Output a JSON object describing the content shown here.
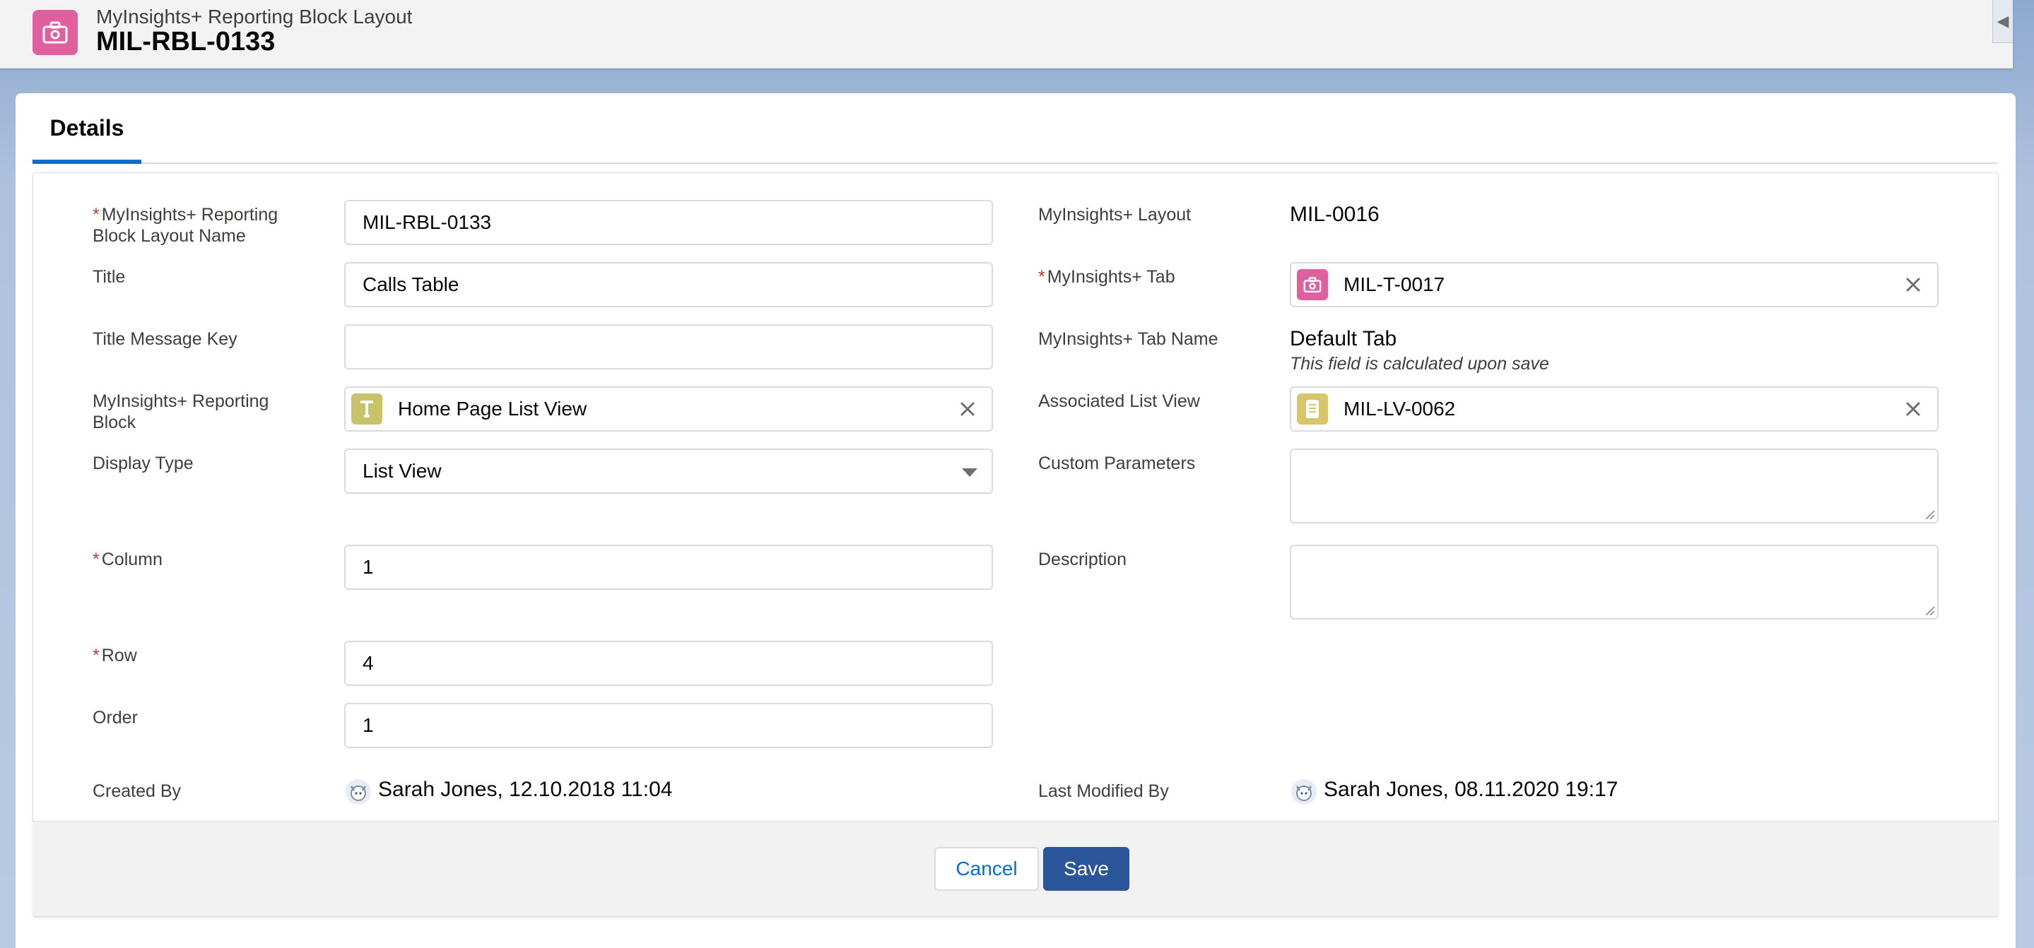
{
  "header": {
    "object_label": "MyInsights+ Reporting Block Layout",
    "record_name": "MIL-RBL-0133",
    "icon": "toolbox-icon",
    "icon_color": "#e0609f"
  },
  "tabs": [
    {
      "label": "Details",
      "active": true
    }
  ],
  "left_fields": {
    "name": {
      "label_line1": "MyInsights+ Reporting",
      "label_line2": "Block Layout Name",
      "required": "*",
      "value": "MIL-RBL-0133"
    },
    "title": {
      "label": "Title",
      "value": "Calls Table"
    },
    "title_message_key": {
      "label": "Title Message Key",
      "value": ""
    },
    "reporting_block": {
      "label_line1": "MyInsights+ Reporting",
      "label_line2": "Block",
      "value": "Home Page List View",
      "icon": "reporting-block-icon",
      "icon_color": "#c8c36b"
    },
    "display_type": {
      "label": "Display Type",
      "value": "List View"
    },
    "column": {
      "label": "Column",
      "required": "*",
      "value": "1"
    },
    "row": {
      "label": "Row",
      "required": "*",
      "value": "4"
    },
    "order": {
      "label": "Order",
      "value": "1"
    },
    "created_by": {
      "label": "Created By",
      "value": "Sarah Jones, 12.10.2018 11:04"
    }
  },
  "right_fields": {
    "layout": {
      "label": "MyInsights+ Layout",
      "value": "MIL-0016"
    },
    "tab": {
      "label": "MyInsights+ Tab",
      "required": "*",
      "value": "MIL-T-0017",
      "icon": "toolbox-icon",
      "icon_color": "#e0609f"
    },
    "tab_name": {
      "label": "MyInsights+ Tab Name",
      "value": "Default Tab",
      "hint": "This field is calculated upon save"
    },
    "list_view": {
      "label": "Associated List View",
      "value": "MIL-LV-0062",
      "icon": "list-view-icon",
      "icon_color": "#d8c76a"
    },
    "custom_parameters": {
      "label": "Custom Parameters",
      "value": ""
    },
    "description": {
      "label": "Description",
      "value": ""
    },
    "last_modified_by": {
      "label": "Last Modified By",
      "value": "Sarah Jones, 08.11.2020 19:17"
    }
  },
  "footer": {
    "cancel_label": "Cancel",
    "save_label": "Save"
  },
  "colors": {
    "brand_blue": "#0070d2",
    "save_button": "#2a5599",
    "required": "#c23934"
  }
}
